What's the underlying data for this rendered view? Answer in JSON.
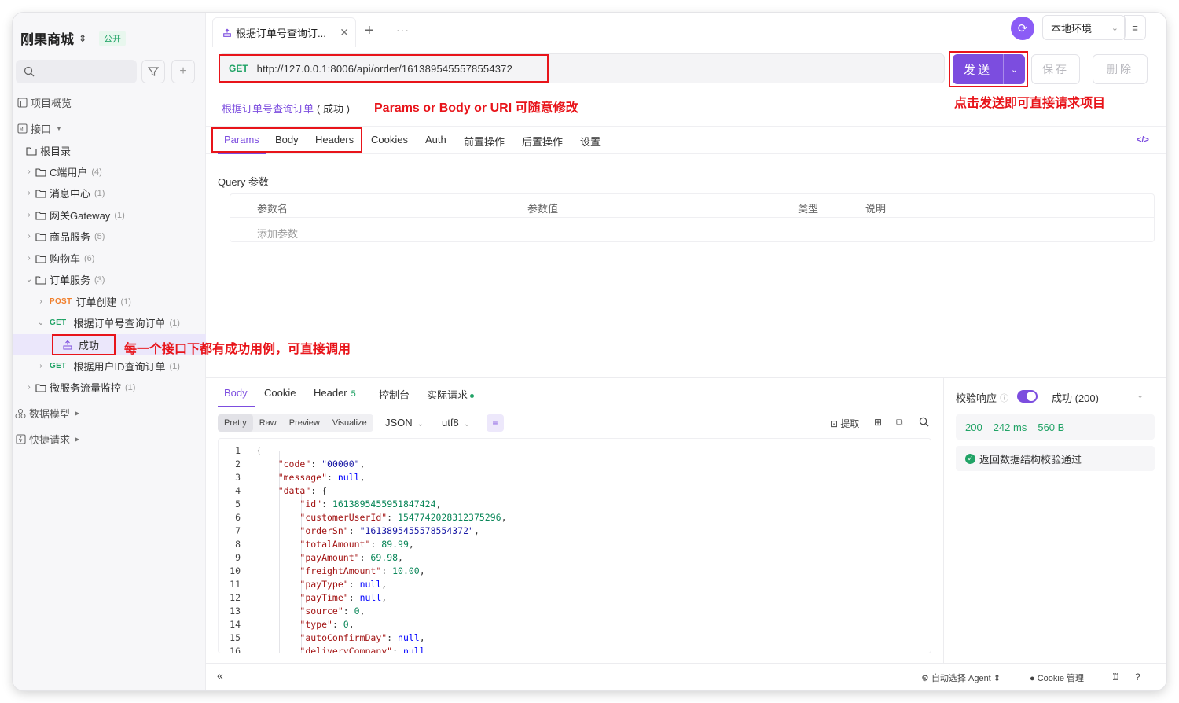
{
  "sidebar": {
    "project_name": "刚果商城",
    "project_badge": "公开",
    "nav": {
      "overview": "项目概览",
      "interfaces": "接口",
      "data_models": "数据模型",
      "quick_requests": "快捷请求"
    },
    "root": "根目录",
    "folders": [
      {
        "label": "C端用户",
        "count": "(4)"
      },
      {
        "label": "消息中心",
        "count": "(1)"
      },
      {
        "label": "网关Gateway",
        "count": "(1)"
      },
      {
        "label": "商品服务",
        "count": "(5)"
      },
      {
        "label": "购物车",
        "count": "(6)"
      },
      {
        "label": "订单服务",
        "count": "(3)"
      }
    ],
    "order_items": [
      {
        "method": "POST",
        "label": "订单创建",
        "count": "(1)"
      },
      {
        "method": "GET",
        "label": "根据订单号查询订单",
        "count": "(1)"
      },
      {
        "method": "",
        "label": "成功",
        "count": ""
      },
      {
        "method": "GET",
        "label": "根据用户ID查询订单",
        "count": "(1)"
      }
    ],
    "last_folder": {
      "label": "微服务流量监控",
      "count": "(1)"
    }
  },
  "tabbar": {
    "active_tab": "根据订单号查询订...",
    "env": "本地环境"
  },
  "request": {
    "method": "GET",
    "url": "http://127.0.0.1:8006/api/order/1613895455578554372",
    "send": "发送",
    "save": "保存",
    "delete": "删除",
    "name": "根据订单号查询订单",
    "status": "( 成功 )"
  },
  "req_tabs": [
    "Params",
    "Body",
    "Headers",
    "Cookies",
    "Auth",
    "前置操作",
    "后置操作",
    "设置"
  ],
  "query": {
    "title": "Query 参数",
    "columns": [
      "参数名",
      "参数值",
      "类型",
      "说明"
    ],
    "add": "添加参数"
  },
  "response": {
    "tabs": [
      "Body",
      "Cookie",
      "Header",
      "控制台",
      "实际请求"
    ],
    "header_count": "5",
    "formats": [
      "Pretty",
      "Raw",
      "Preview",
      "Visualize"
    ],
    "lang": "JSON",
    "encoding": "utf8",
    "extract": "提取",
    "code_lines": [
      "{",
      "    \"code\": \"00000\",",
      "    \"message\": null,",
      "    \"data\": {",
      "        \"id\": 1613895455951847424,",
      "        \"customerUserId\": 1547742028312375296,",
      "        \"orderSn\": \"1613895455578554372\",",
      "        \"totalAmount\": 89.99,",
      "        \"payAmount\": 69.98,",
      "        \"freightAmount\": 10.00,",
      "        \"payType\": null,",
      "        \"payTime\": null,",
      "        \"source\": 0,",
      "        \"type\": 0,",
      "        \"autoConfirmDay\": null,",
      "        \"deliveryCompany\": null,"
    ]
  },
  "validation": {
    "label": "校验响应",
    "selected": "成功 (200)",
    "status_code": "200",
    "time": "242 ms",
    "size": "560 B",
    "result": "返回数据结构校验通过"
  },
  "footer": {
    "agent": "自动选择 Agent",
    "cookie": "Cookie 管理"
  },
  "annotations": {
    "edit_tip": "Params or Body or URI 可随意修改",
    "send_tip": "点击发送即可直接请求项目",
    "case_tip": "每一个接口下都有成功用例，可直接调用"
  },
  "colors": {
    "accent": "#7c4ddf",
    "get": "#21a366",
    "post": "#f07f2c",
    "annotation": "#e8141a"
  }
}
